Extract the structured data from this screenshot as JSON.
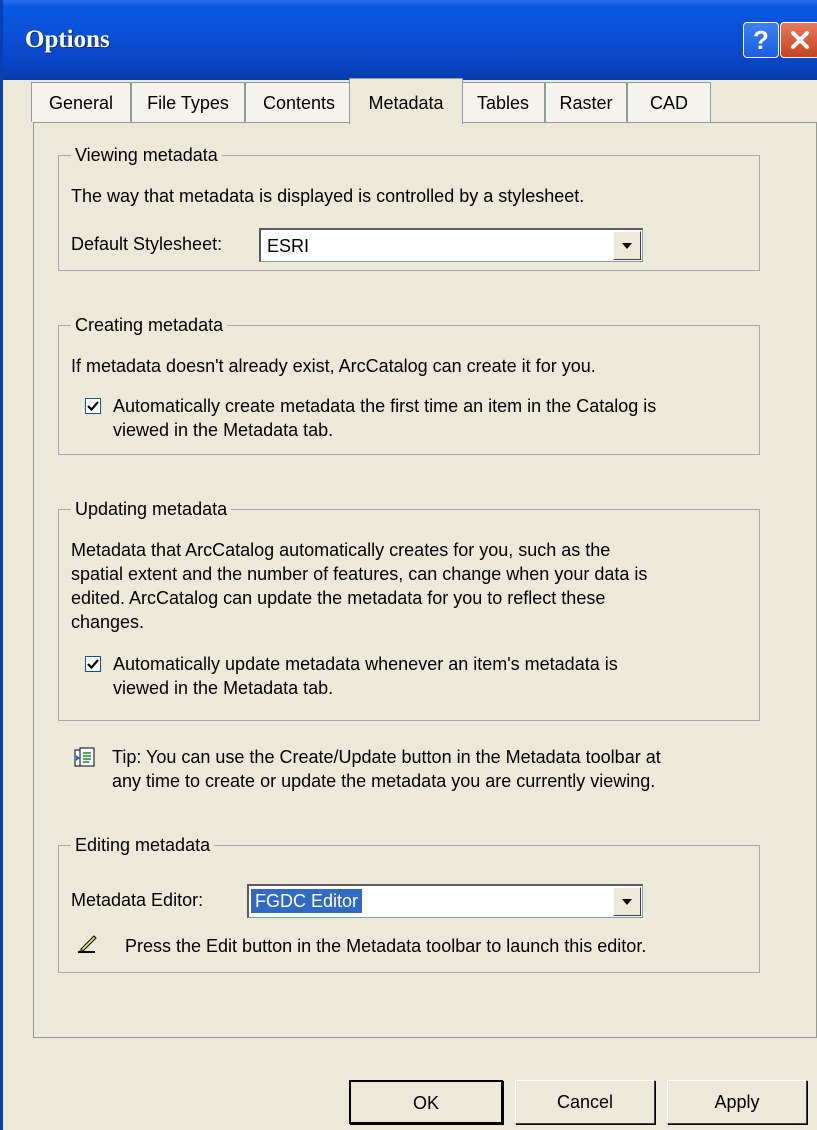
{
  "window": {
    "title": "Options",
    "help_symbol": "?"
  },
  "tabs": [
    {
      "label": "General"
    },
    {
      "label": "File Types"
    },
    {
      "label": "Contents"
    },
    {
      "label": "Metadata",
      "active": true
    },
    {
      "label": "Tables"
    },
    {
      "label": "Raster"
    },
    {
      "label": "CAD"
    }
  ],
  "viewing": {
    "title": "Viewing metadata",
    "description": "The way that metadata is displayed is controlled by a stylesheet.",
    "stylesheet_label": "Default Stylesheet:",
    "stylesheet_value": "ESRI"
  },
  "creating": {
    "title": "Creating metadata",
    "description": "If metadata doesn't already exist, ArcCatalog can create it for you.",
    "checkbox_line1": "Automatically create metadata the first time an item in the Catalog is",
    "checkbox_line2": "viewed in the Metadata tab.",
    "checked": true
  },
  "updating": {
    "title": "Updating metadata",
    "desc_line1": "Metadata that ArcCatalog automatically creates for you, such as the",
    "desc_line2": "spatial extent and the number of features, can change when your data is",
    "desc_line3": "edited.  ArcCatalog can update the metadata for you to reflect these",
    "desc_line4": "changes.",
    "checkbox_line1": "Automatically update metadata whenever an item's metadata is",
    "checkbox_line2": "viewed in the Metadata tab.",
    "checked": true
  },
  "tip": {
    "line1": "Tip: You can use the Create/Update button in the Metadata toolbar at",
    "line2": "any time to create or update the metadata you are currently viewing.",
    "icon": "create-update-metadata-icon"
  },
  "editing": {
    "title": "Editing metadata",
    "editor_label": "Metadata Editor:",
    "editor_value": "FGDC Editor",
    "hint": "Press the Edit button in the Metadata toolbar to launch this editor.",
    "icon": "edit-metadata-icon"
  },
  "buttons": {
    "ok": "OK",
    "cancel": "Cancel",
    "apply": "Apply"
  },
  "colors": {
    "titlebar": "#0a4fd6",
    "dialog_bg": "#ece9d8",
    "selection": "#316ac5"
  }
}
